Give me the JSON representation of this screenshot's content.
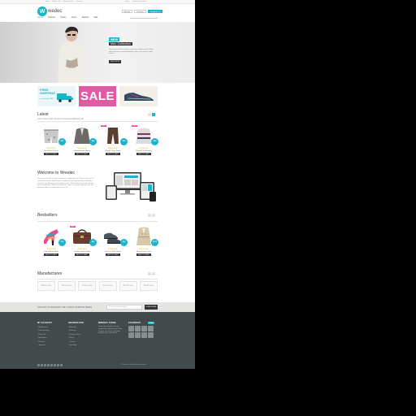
{
  "topbar": {
    "links": [
      "Home",
      "Wishlist (0)",
      "Shopping Cart",
      "Checkout"
    ],
    "account": [
      "Login",
      "Create an account"
    ]
  },
  "header": {
    "logo_letter": "W",
    "logo_word": "wedec",
    "buttons": [
      "Account",
      "Checkout",
      "Shopping Cart"
    ],
    "search_placeholder": "Search"
  },
  "nav": [
    "Home",
    "Fashion",
    "Shoes",
    "Jeans",
    "Jackets",
    "Sale"
  ],
  "hero": {
    "badge_new": "NEW",
    "badge_title": "Men Collection",
    "description": "Lorem ipsum dolor sit amet, consectetur adipiscing elit. Sed at tortor quis lacus commodo dapibus. Nunc vitae lorem et nibh viverra.",
    "shop_label": "SHOP NOW"
  },
  "promos": {
    "shipping_title": "FREE",
    "shipping_sub": "SHIPPING",
    "shipping_note": "on all orders $99",
    "sale_label": "SALE"
  },
  "latest": {
    "title": "Latest",
    "subtitle": "Lorem ipsum dolor sit amet consectetur adipiscing elit",
    "products": [
      {
        "name": "Floral Print Shorts",
        "price": "$49",
        "flag": "",
        "cart": "ADD TO CART"
      },
      {
        "name": "Casual Suede Blazer",
        "price": "$89",
        "flag": "",
        "cart": "ADD TO CART"
      },
      {
        "name": "Brown Chino Pants",
        "price": "$59",
        "flag": "NEW",
        "cart": "ADD TO CART"
      },
      {
        "name": "Striped Knit Sweater",
        "price": "$69",
        "flag": "SALE",
        "cart": "ADD TO CART"
      }
    ],
    "stars": "★★★★★"
  },
  "welcome": {
    "title": "Welcome to Wnedec",
    "text": "Lorem ipsum dolor sit amet, consectetur adipiscing elit. Praesent vel nisl eu est facilisis dictum. Nulla facilisi. Vestibulum ante ipsum primis in faucibus orci luctus et ultrices posuere cubilia curae. Sed sit amet ipsum quis mauris iaculis vestibulum. Maecenas dignissim, libero eu egestas posuere, dui elit interdum nibh, a faucibus lorem mi in nisi."
  },
  "bestsellers": {
    "title": "Bestsellers",
    "products": [
      {
        "name": "Colour Block Heels",
        "price": "$79",
        "flag": "",
        "cart": "ADD TO CART"
      },
      {
        "name": "Leather Satchel Bag",
        "price": "$99",
        "flag": "NEW",
        "cart": "ADD TO CART"
      },
      {
        "name": "Classic Derby Shoes",
        "price": "$69",
        "flag": "",
        "cart": "ADD TO CART"
      },
      {
        "name": "Beige Trench Coat",
        "price": "$129",
        "flag": "",
        "cart": "ADD TO CART"
      }
    ],
    "stars": "★★★★★"
  },
  "manufactures": {
    "title": "Manufactures",
    "brands": [
      "Brand Logo",
      "Brand Logo",
      "Brand Logo",
      "Brand Logo",
      "Brand Logo",
      "Brand Logo"
    ]
  },
  "newsletter": {
    "label": "SIGN UP TO RECEIVE THE LATEST FASHION NEWS",
    "placeholder": "Enter your email address",
    "button": "SUBSCRIBE"
  },
  "footer": {
    "account_title": "MY ACCOUNT",
    "account_items": [
      "My Account",
      "Order History",
      "Wish List",
      "Newsletter",
      "Returns",
      "Specials"
    ],
    "info_title": "INFORMATION",
    "info_items": [
      "About Us",
      "Delivery",
      "Privacy Policy",
      "Terms",
      "Contact",
      "Site Map"
    ],
    "about_title": "WNEDEC STORE",
    "about_text": "Lorem ipsum dolor sit amet, consectetur adipiscing elit. Sed at tortor quis lacus commodo dapibus nunc vitae lorem.",
    "facebook_title": "FACEBOOK",
    "like_label": "Like",
    "copyright": "© Wnedec Store. All rights reserved."
  },
  "colors": {
    "accent": "#1bb5c9",
    "sale": "#e35aa4",
    "footer": "#434a4b"
  }
}
